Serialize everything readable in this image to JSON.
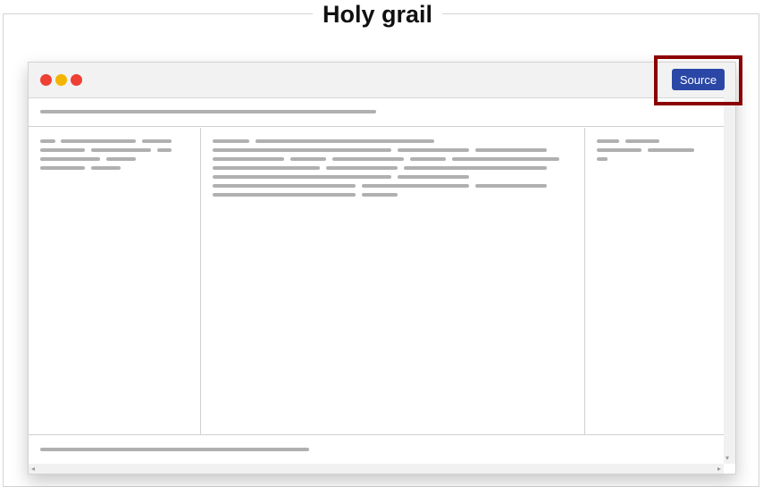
{
  "page": {
    "title": "Holy grail"
  },
  "window": {
    "controls": {
      "close_color": "#ee4035",
      "minimize_color": "#f4b400",
      "zoom_color": "#ee4035"
    },
    "source_button": {
      "label": "Source",
      "color": "#2a47a6"
    },
    "highlight_color": "#8b0000",
    "placeholder_color": "#b0b0b0"
  },
  "icons": {
    "scroll_down": "▾",
    "scroll_left": "◂",
    "scroll_right": "▸"
  }
}
